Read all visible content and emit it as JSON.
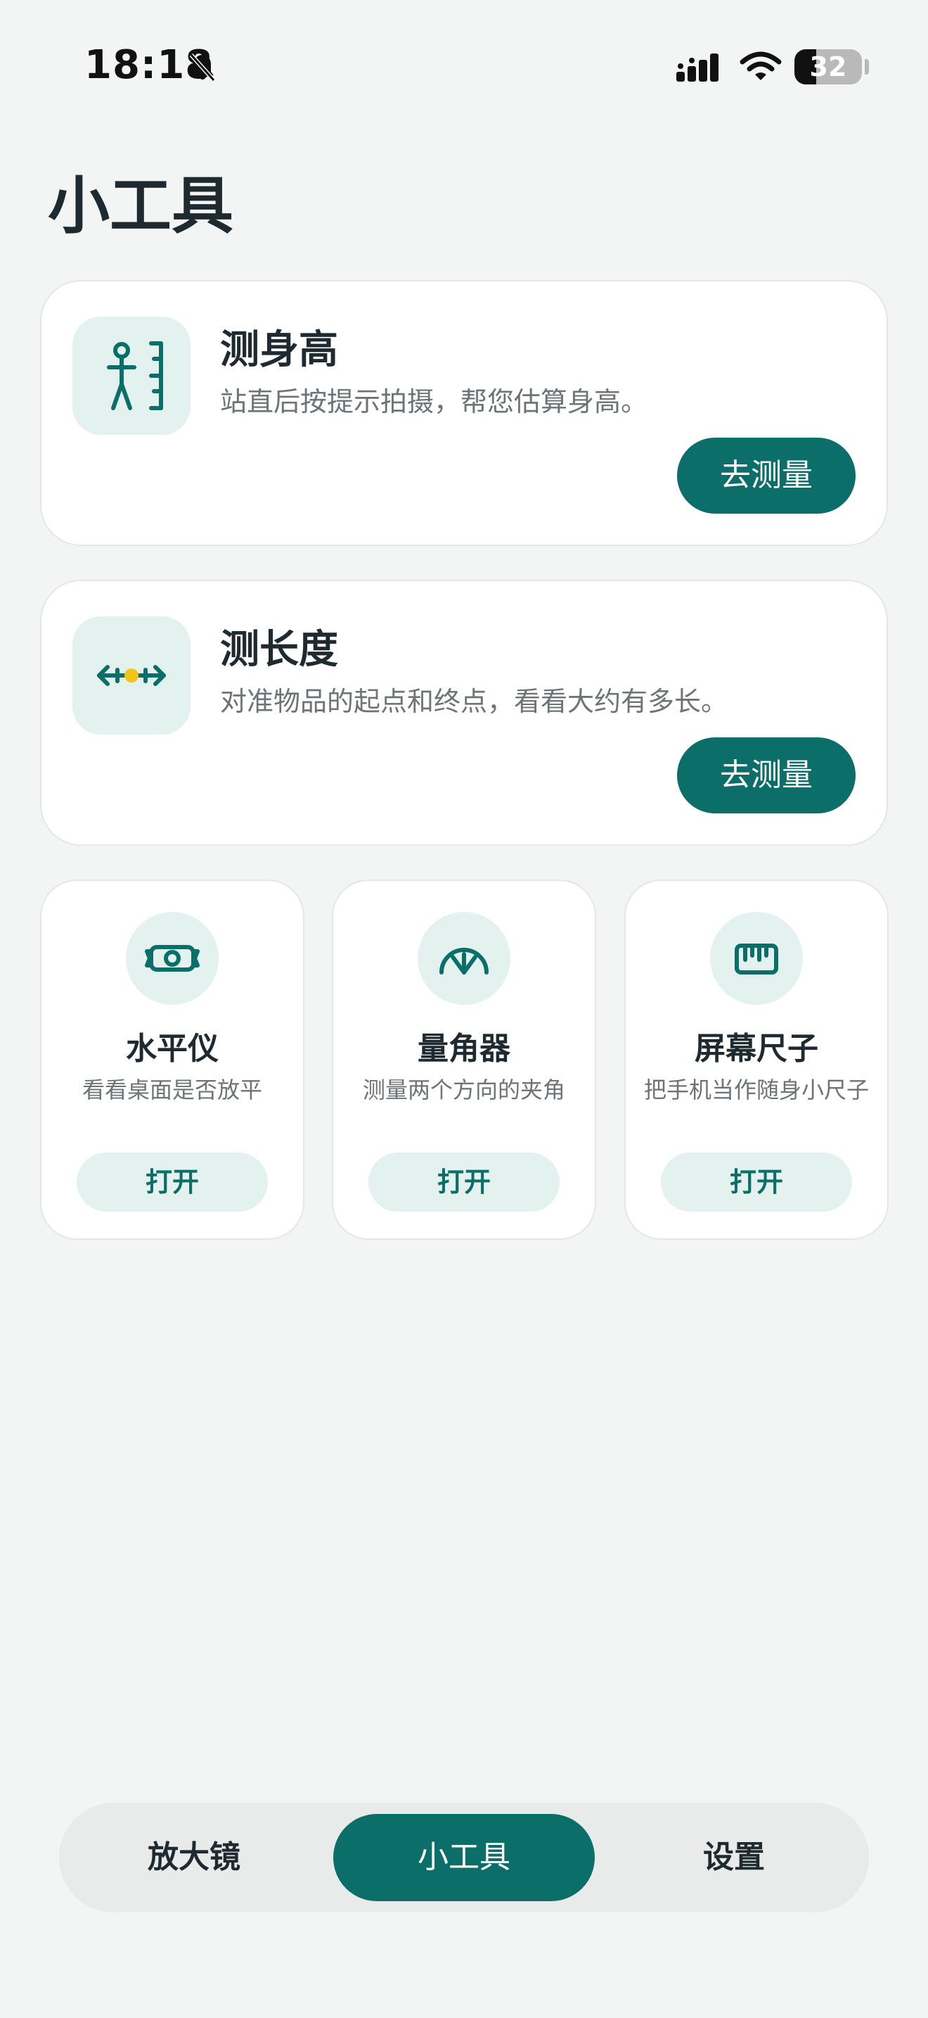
{
  "status_bar": {
    "time": "18:18",
    "battery_level": "32",
    "icons": [
      "bell-muted-icon",
      "signal-icon",
      "wifi-icon",
      "battery-icon"
    ]
  },
  "page": {
    "title": "小工具"
  },
  "tools_wide": [
    {
      "icon": "height-ruler-icon",
      "title": "测身高",
      "desc": "站直后按提示拍摄，帮您估算身高。",
      "button": "去测量"
    },
    {
      "icon": "length-arrows-icon",
      "title": "测长度",
      "desc": "对准物品的起点和终点，看看大约有多长。",
      "button": "去测量"
    }
  ],
  "tools_small": [
    {
      "icon": "level-icon",
      "title": "水平仪",
      "desc": "看看桌面是否放平",
      "button": "打开"
    },
    {
      "icon": "protractor-icon",
      "title": "量角器",
      "desc": "测量两个方向的夹角",
      "button": "打开"
    },
    {
      "icon": "ruler-icon",
      "title": "屏幕尺子",
      "desc": "把手机当作随身小尺子",
      "button": "打开"
    }
  ],
  "bottom_nav": {
    "items": [
      "放大镜",
      "小工具",
      "设置"
    ],
    "active": "小工具"
  },
  "colors": {
    "accent": "#0b6e69",
    "accent_light": "#e3f2ef",
    "background": "#f3f5f4",
    "highlight_dot": "#f2c41a"
  }
}
